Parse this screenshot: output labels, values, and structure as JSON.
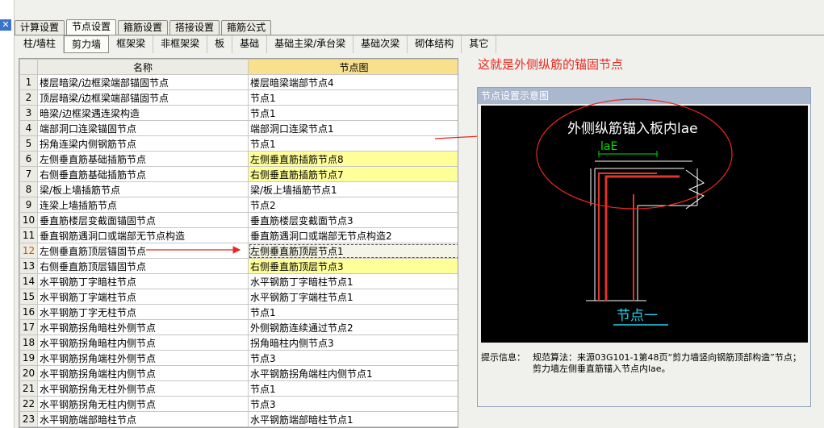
{
  "main_tabs": [
    "计算设置",
    "节点设置",
    "箍筋设置",
    "搭接设置",
    "箍筋公式"
  ],
  "sub_tabs": [
    "柱/墙柱",
    "剪力墙",
    "框架梁",
    "非框架梁",
    "板",
    "基础",
    "基础主梁/承台梁",
    "基础次梁",
    "砌体结构",
    "其它"
  ],
  "table": {
    "headers": [
      "名称",
      "节点图"
    ],
    "rows": [
      {
        "no": "1",
        "name": "楼层暗梁/边框梁端部锚固节点",
        "node": "楼层暗梁端部节点4"
      },
      {
        "no": "2",
        "name": "顶层暗梁/边框梁端部锚固节点",
        "node": "节点1"
      },
      {
        "no": "3",
        "name": "暗梁/边框梁遇连梁构造",
        "node": "节点1"
      },
      {
        "no": "4",
        "name": "端部洞口连梁锚固节点",
        "node": "端部洞口连梁节点1"
      },
      {
        "no": "5",
        "name": "拐角连梁内侧钢筋节点",
        "node": "节点1"
      },
      {
        "no": "6",
        "name": "左侧垂直筋基础插筋节点",
        "node": "左侧垂直筋插筋节点8",
        "hl": true
      },
      {
        "no": "7",
        "name": "右侧垂直筋基础插筋节点",
        "node": "右侧垂直筋插筋节点7",
        "hl": true
      },
      {
        "no": "8",
        "name": "梁/板上墙插筋节点",
        "node": "梁/板上墙插筋节点1"
      },
      {
        "no": "9",
        "name": "连梁上墙插筋节点",
        "node": "节点2"
      },
      {
        "no": "10",
        "name": "垂直筋楼层变截面锚固节点",
        "node": "垂直筋楼层变截面节点3"
      },
      {
        "no": "11",
        "name": "垂直钢筋遇洞口或端部无节点构造",
        "node": "垂直筋遇洞口或端部无节点构造2"
      },
      {
        "no": "12",
        "name": "左侧垂直筋顶层锚固节点",
        "node": "左侧垂直筋顶层节点1",
        "sel": true
      },
      {
        "no": "13",
        "name": "右侧垂直筋顶层锚固节点",
        "node": "右侧垂直筋顶层节点3",
        "hl": true
      },
      {
        "no": "14",
        "name": "水平钢筋丁字暗柱节点",
        "node": "水平钢筋丁字暗柱节点1"
      },
      {
        "no": "15",
        "name": "水平钢筋丁字端柱节点",
        "node": "水平钢筋丁字端柱节点1"
      },
      {
        "no": "16",
        "name": "水平钢筋丁字无柱节点",
        "node": "节点1"
      },
      {
        "no": "17",
        "name": "水平钢筋拐角暗柱外侧节点",
        "node": "外侧钢筋连续通过节点2"
      },
      {
        "no": "18",
        "name": "水平钢筋拐角暗柱内侧节点",
        "node": "拐角暗柱内侧节点3"
      },
      {
        "no": "19",
        "name": "水平钢筋拐角端柱外侧节点",
        "node": "节点3"
      },
      {
        "no": "20",
        "name": "水平钢筋拐角端柱内侧节点",
        "node": "水平钢筋拐角端柱内侧节点1"
      },
      {
        "no": "21",
        "name": "水平钢筋拐角无柱外侧节点",
        "node": "节点1"
      },
      {
        "no": "22",
        "name": "水平钢筋拐角无柱内侧节点",
        "node": "节点3"
      },
      {
        "no": "23",
        "name": "水平钢筋端部暗柱节点",
        "node": "水平钢筋端部暗柱节点1"
      }
    ]
  },
  "annotation": "这就是外侧纵筋的锚固节点",
  "panel": {
    "title": "节点设置示意图",
    "diagram_label_top": "外侧纵筋锚入板内lae",
    "diagram_label_lae": "laE",
    "diagram_caption": "节点一",
    "hint_label": "提示信息：",
    "hint_text": "规范算法：来源03G101-1第48页“剪力墙竖向钢筋顶部构造”节点；剪力墙左侧垂直筋锚入节点内lae。"
  },
  "colors": {
    "highlight_row": "#ffff99",
    "annotation_red": "#e8281e",
    "rebar_red": "#e53228",
    "lae_green": "#00e000",
    "caption_cyan": "#22d3ee"
  }
}
